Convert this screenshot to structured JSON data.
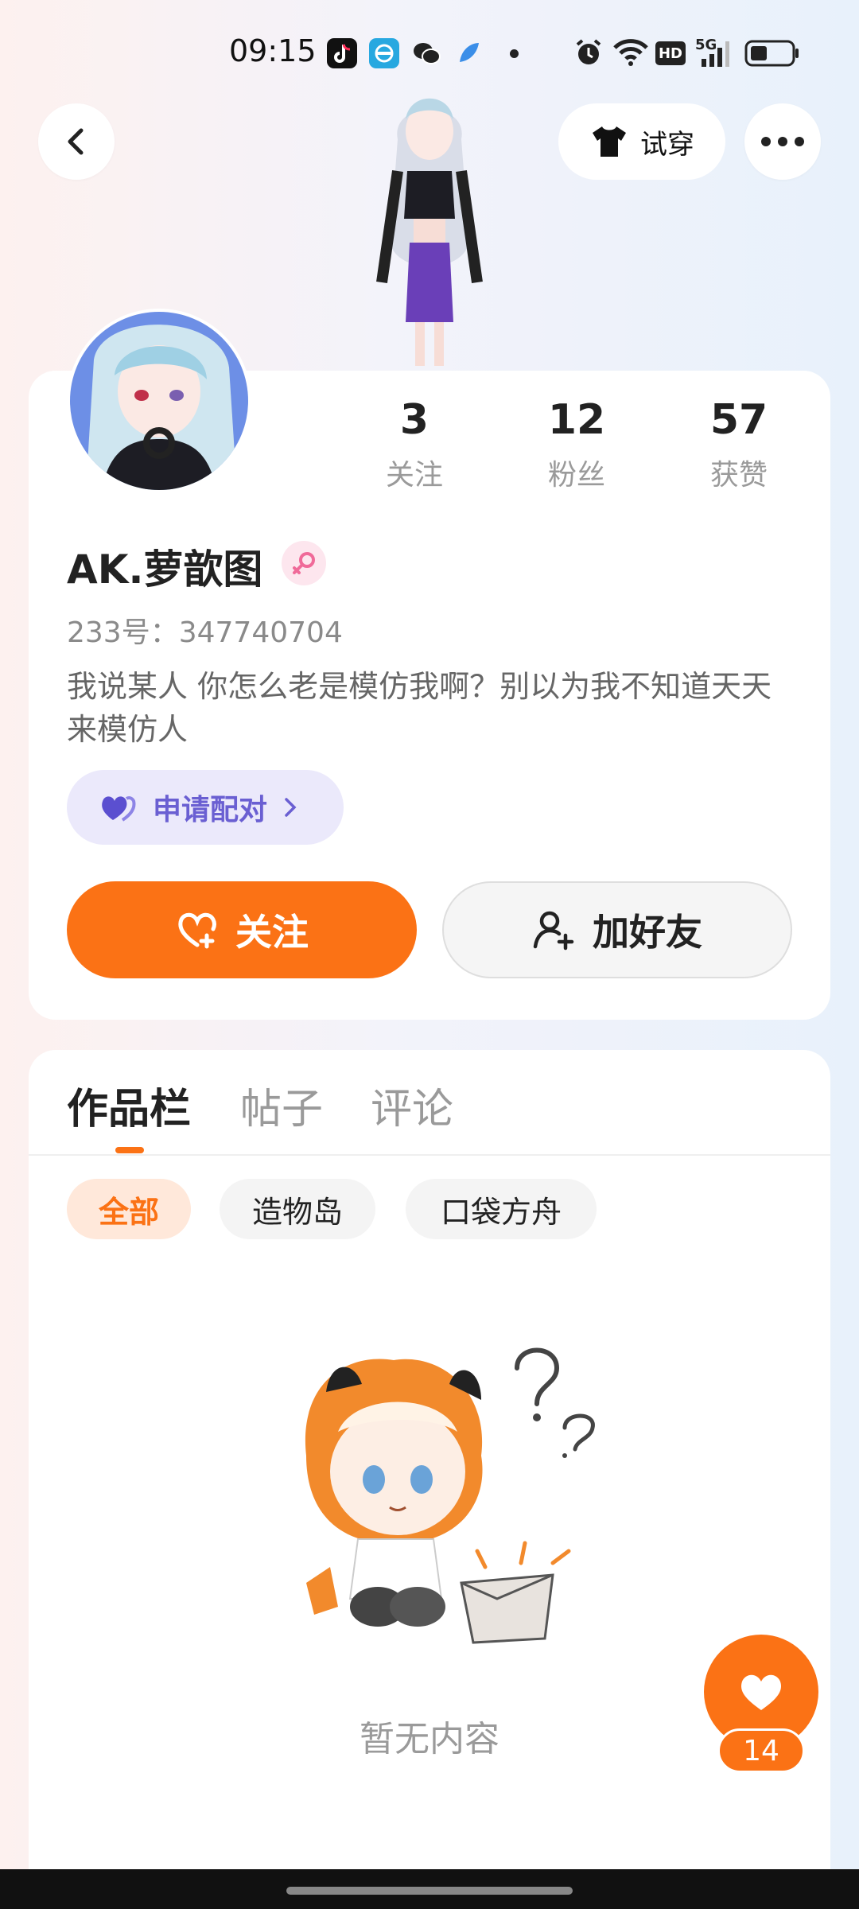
{
  "status_bar": {
    "time": "09:15",
    "apps": [
      "tiktok-icon",
      "tplink-icon",
      "wechat-icon",
      "feather-icon"
    ],
    "system_icons": [
      "alarm-icon",
      "wifi-icon",
      "hd-icon",
      "5g-signal-icon",
      "battery-icon"
    ],
    "hd_label": "HD",
    "net_label": "5G"
  },
  "header": {
    "tryon_label": "试穿"
  },
  "profile": {
    "name": "AK.萝歆图",
    "uid": "233号：347740704",
    "bio": "我说某人 你怎么老是模仿我啊？别以为我不知道天天来模仿人",
    "pair_label": "申请配对",
    "stats": [
      {
        "value": "3",
        "label": "关注"
      },
      {
        "value": "12",
        "label": "粉丝"
      },
      {
        "value": "57",
        "label": "获赞"
      }
    ],
    "follow_label": "关注",
    "add_friend_label": "加好友"
  },
  "tabs": [
    {
      "label": "作品栏",
      "active": true
    },
    {
      "label": "帖子",
      "active": false
    },
    {
      "label": "评论",
      "active": false
    }
  ],
  "filters": [
    {
      "label": "全部",
      "active": true
    },
    {
      "label": "造物岛",
      "active": false
    },
    {
      "label": "口袋方舟",
      "active": false
    }
  ],
  "empty_text": "暂无内容",
  "like_count": "14",
  "colors": {
    "accent": "#fb7215",
    "pair_bg": "#ebe9fb",
    "pair_fg": "#6a5fd2"
  }
}
